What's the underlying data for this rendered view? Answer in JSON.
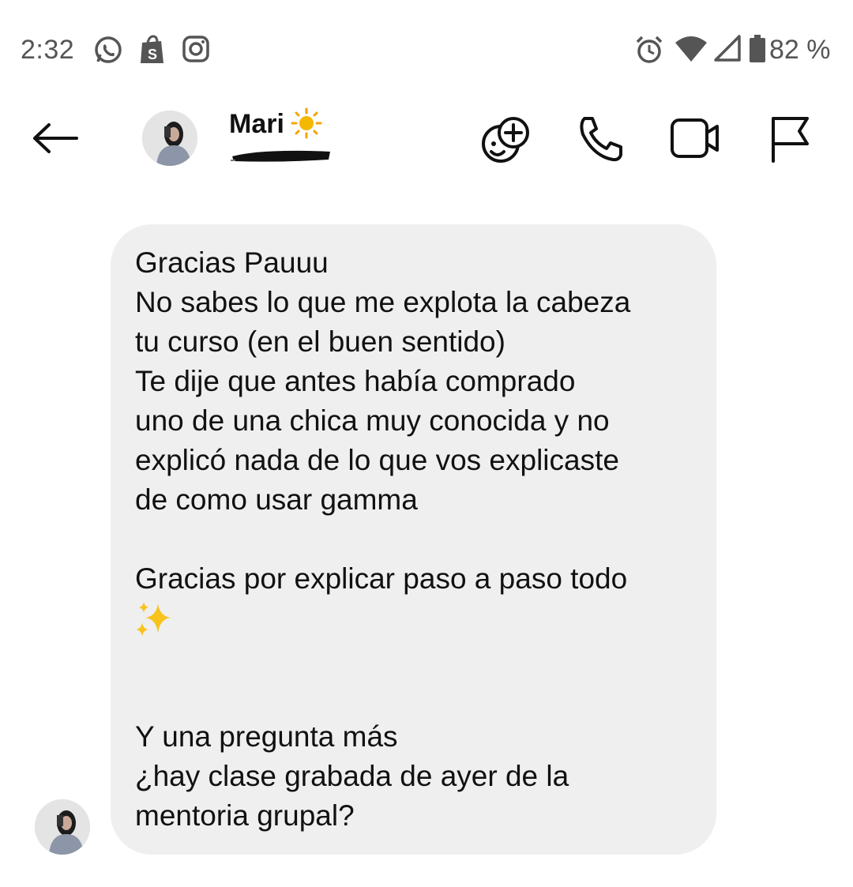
{
  "status_bar": {
    "time": "2:32",
    "battery_percent": "82 %",
    "icons": [
      "whatsapp-icon",
      "shopify-icon",
      "instagram-icon",
      "alarm-icon",
      "wifi-icon",
      "signal-icon",
      "battery-icon"
    ]
  },
  "header": {
    "contact_name": "Mari",
    "name_emoji": "sun-icon",
    "icons": [
      "back-arrow-icon",
      "add-effect-icon",
      "phone-icon",
      "video-icon",
      "flag-icon"
    ]
  },
  "message": {
    "lines": [
      "Gracias Pauuu",
      "No sabes lo que me explota la cabeza",
      "tu curso (en el buen sentido)",
      "Te dije que antes había comprado",
      "uno de una chica muy conocida y no",
      "explicó nada de lo que vos explicaste",
      "de como usar gamma",
      "Gracias por explicar paso a paso todo",
      "Y una pregunta más",
      "¿hay clase grabada de ayer de la",
      "mentoria grupal?"
    ],
    "sparkle_emoji": "sparkles-icon"
  },
  "colors": {
    "bubble": "#efefef",
    "text": "#111111",
    "status_text": "#555555",
    "sun": "#f5b800"
  }
}
